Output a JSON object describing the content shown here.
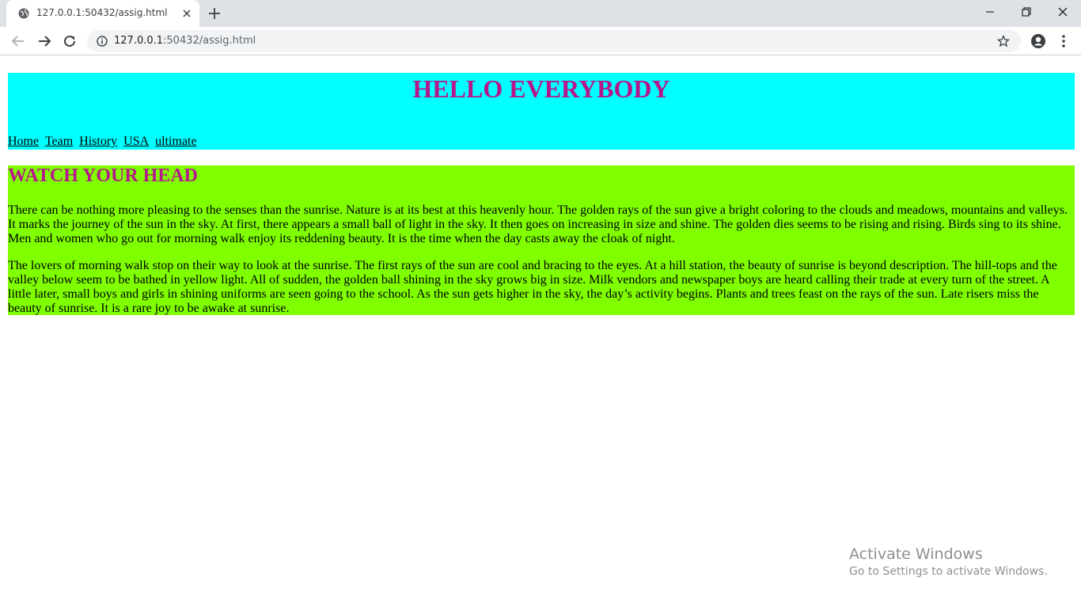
{
  "browser": {
    "tab": {
      "title": "127.0.0.1:50432/assig.html"
    },
    "address": {
      "host": "127.0.0.1",
      "path": ":50432/assig.html"
    }
  },
  "page": {
    "header": {
      "title": "HELLO EVERYBODY",
      "nav": [
        "Home",
        "Team",
        "History",
        "USA",
        "ultimate"
      ]
    },
    "section": {
      "title": "WATCH YOUR HEAD",
      "paragraphs": [
        "There can be nothing more pleasing to the senses than the sunrise. Nature is at its best at this heavenly hour. The golden rays of the sun give a bright coloring to the clouds and meadows, mountains and valleys. It marks the journey of the sun in the sky. At first, there appears a small ball of light in the sky. It then goes on increasing in size and shine. The golden dies seems to be rising and rising. Birds sing to its shine. Men and women who go out for morning walk enjoy its reddening beauty. It is the time when the day casts away the cloak of night.",
        "The lovers of morning walk stop on their way to look at the sunrise. The first rays of the sun are cool and bracing to the eyes. At a hill station, the beauty of sunrise is beyond description.  The hill-tops and the valley below seem to be bathed in yellow light. All of sudden, the golden ball shining in the sky grows big in size. Milk vendors and newspaper boys are heard calling their trade at every turn of the street. A little later, small boys and girls in shining uniforms are seen going to the school. As the sun gets higher in the sky, the day’s activity begins. Plants and trees feast on the rays of the sun. Late risers miss the beauty of sunrise. It is a rare joy to be awake at sunrise."
      ]
    }
  },
  "watermark": {
    "line1": "Activate Windows",
    "line2": "Go to Settings to activate Windows."
  },
  "colors": {
    "header_bg": "#00ffff",
    "section_bg": "#80ff00",
    "heading_text": "#b5178a"
  }
}
